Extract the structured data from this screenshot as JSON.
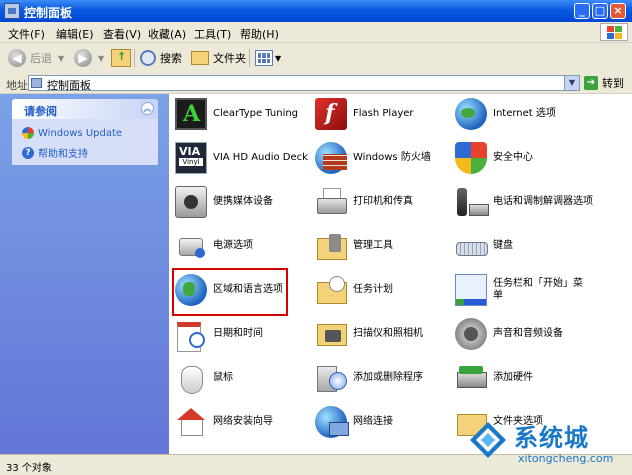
{
  "window": {
    "title": "控制面板"
  },
  "menu": [
    "文件(F)",
    "编辑(E)",
    "查看(V)",
    "收藏(A)",
    "工具(T)",
    "帮助(H)"
  ],
  "toolbar": {
    "back": "后退",
    "search": "搜索",
    "folders": "文件夹"
  },
  "address": {
    "label": "地址(D)",
    "value": "控制面板",
    "go": "转到"
  },
  "sidebar": {
    "title": "请参阅",
    "links": [
      "Windows Update",
      "帮助和支持"
    ]
  },
  "items": [
    {
      "label": "ClearType Tuning",
      "icon": "cleartype-icon"
    },
    {
      "label": "Flash Player",
      "icon": "flash-icon"
    },
    {
      "label": "Internet 选项",
      "icon": "internet-options-icon"
    },
    {
      "label": "VIA HD Audio Deck",
      "icon": "via-audio-icon"
    },
    {
      "label": "Windows 防火墙",
      "icon": "firewall-icon"
    },
    {
      "label": "安全中心",
      "icon": "security-center-icon"
    },
    {
      "label": "便携媒体设备",
      "icon": "portable-media-icon"
    },
    {
      "label": "打印机和传真",
      "icon": "printer-icon"
    },
    {
      "label": "电话和调制解调器选项",
      "icon": "phone-modem-icon"
    },
    {
      "label": "电源选项",
      "icon": "power-icon"
    },
    {
      "label": "管理工具",
      "icon": "admin-tools-icon"
    },
    {
      "label": "键盘",
      "icon": "keyboard-icon"
    },
    {
      "label": "区域和语言选项",
      "icon": "regional-language-icon"
    },
    {
      "label": "任务计划",
      "icon": "scheduled-tasks-icon"
    },
    {
      "label": "任务栏和「开始」菜单",
      "icon": "taskbar-icon"
    },
    {
      "label": "日期和时间",
      "icon": "date-time-icon"
    },
    {
      "label": "扫描仪和照相机",
      "icon": "scanner-camera-icon"
    },
    {
      "label": "声音和音频设备",
      "icon": "sound-icon"
    },
    {
      "label": "鼠标",
      "icon": "mouse-icon"
    },
    {
      "label": "添加或删除程序",
      "icon": "add-remove-icon"
    },
    {
      "label": "添加硬件",
      "icon": "add-hardware-icon"
    },
    {
      "label": "网络安装向导",
      "icon": "network-wizard-icon"
    },
    {
      "label": "网络连接",
      "icon": "network-connections-icon"
    },
    {
      "label": "文件夹选项",
      "icon": "folder-options-icon"
    }
  ],
  "status": {
    "text": "33 个对象"
  },
  "watermark": {
    "title": "系统城",
    "sub": "xitongcheng.com"
  },
  "colors": {
    "title_blue": "#0a5ae0",
    "sidebar_blue": "#7ba2e7",
    "link_blue": "#215dc6",
    "highlight_red": "#d40000"
  }
}
